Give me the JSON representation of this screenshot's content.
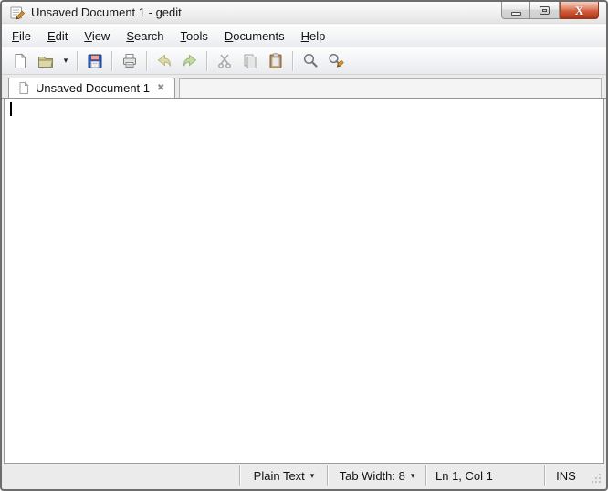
{
  "window": {
    "title": "Unsaved Document 1 - gedit",
    "app_icon": "gedit-notepad-pencil-icon",
    "controls": [
      "minimize-icon",
      "maximize-icon",
      "close-icon"
    ]
  },
  "icons": {
    "dropdown_arrow": "▾",
    "tab_close": "✖",
    "window_close_glyph": "X"
  },
  "colors": {
    "close_button_red": "#c8441f",
    "save_floppy_blue": "#2f5bb7",
    "save_label_red": "#d94f3c",
    "folder_khaki": "#cdc98f",
    "pencil_orange": "#e0952e",
    "chrome_gray": "#ebebeb"
  },
  "menubar": {
    "items": [
      {
        "mnemonic": "F",
        "rest": "ile"
      },
      {
        "mnemonic": "E",
        "rest": "dit"
      },
      {
        "mnemonic": "V",
        "rest": "iew"
      },
      {
        "mnemonic": "S",
        "rest": "earch"
      },
      {
        "mnemonic": "T",
        "rest": "ools"
      },
      {
        "mnemonic": "D",
        "rest": "ocuments"
      },
      {
        "mnemonic": "H",
        "rest": "elp"
      }
    ]
  },
  "toolbar": {
    "buttons": [
      {
        "name": "new",
        "icon": "new-document-icon",
        "enabled": true
      },
      {
        "name": "open",
        "icon": "open-folder-icon",
        "enabled": true
      },
      {
        "name": "open-menu",
        "icon": "dropdown-arrow-icon",
        "enabled": true
      },
      {
        "name": "save",
        "icon": "save-floppy-icon",
        "enabled": true
      },
      {
        "name": "print",
        "icon": "print-icon",
        "enabled": true
      },
      {
        "name": "undo",
        "icon": "undo-arrow-icon",
        "enabled": false
      },
      {
        "name": "redo",
        "icon": "redo-arrow-icon",
        "enabled": false
      },
      {
        "name": "cut",
        "icon": "cut-scissors-icon",
        "enabled": false
      },
      {
        "name": "copy",
        "icon": "copy-pages-icon",
        "enabled": false
      },
      {
        "name": "paste",
        "icon": "paste-clipboard-icon",
        "enabled": false
      },
      {
        "name": "find",
        "icon": "find-magnifier-icon",
        "enabled": true
      },
      {
        "name": "replace",
        "icon": "replace-magnifier-pencil-icon",
        "enabled": true
      }
    ]
  },
  "tabbar": {
    "tabs": [
      {
        "label": "Unsaved Document 1",
        "active": true,
        "icon": "document-icon"
      }
    ]
  },
  "editor": {
    "content": "",
    "caret": "line 1 column 1"
  },
  "statusbar": {
    "language": "Plain Text",
    "tab_width": "Tab Width: 8",
    "position": "Ln 1, Col 1",
    "mode": "INS"
  }
}
